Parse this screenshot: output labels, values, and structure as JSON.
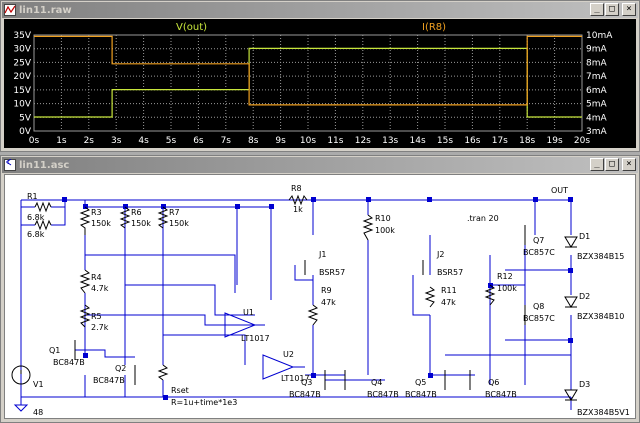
{
  "waveform_window": {
    "title": "lin11.raw",
    "buttons": {
      "minimize": "_",
      "maximize": "□",
      "close": "×"
    },
    "traces": [
      {
        "name": "V(out)",
        "color": "#C8E63C"
      },
      {
        "name": "I(R8)",
        "color": "#F0A020"
      }
    ],
    "left_axis": [
      "35V",
      "30V",
      "25V",
      "20V",
      "15V",
      "10V",
      "5V",
      "0V"
    ],
    "right_axis": [
      "10mA",
      "9mA",
      "8mA",
      "7mA",
      "6mA",
      "5mA",
      "4mA",
      "3mA"
    ],
    "x_axis": [
      "0s",
      "1s",
      "2s",
      "3s",
      "4s",
      "5s",
      "6s",
      "7s",
      "8s",
      "9s",
      "10s",
      "11s",
      "12s",
      "13s",
      "14s",
      "15s",
      "16s",
      "17s",
      "18s",
      "19s",
      "20s"
    ]
  },
  "chart_data": {
    "type": "line",
    "xlabel": "",
    "x_unit": "s",
    "xlim": [
      0,
      20
    ],
    "ylim_left": [
      0,
      35
    ],
    "ylim_right": [
      3,
      10
    ],
    "grid": true,
    "series": [
      {
        "name": "V(out)",
        "axis": "left",
        "color": "#C8E63C",
        "x": [
          0,
          2.85,
          2.85,
          7.85,
          7.85,
          18.0,
          18.0,
          20.0
        ],
        "y": [
          5.1,
          5.1,
          15.1,
          15.1,
          30.1,
          30.1,
          5.1,
          5.1
        ]
      },
      {
        "name": "I(R8)",
        "axis": "right",
        "color": "#F0A020",
        "x": [
          0,
          2.85,
          2.85,
          7.85,
          7.85,
          18.0,
          18.0,
          20.0
        ],
        "y": [
          9.9,
          9.9,
          7.9,
          7.9,
          4.9,
          4.9,
          9.9,
          9.9
        ]
      }
    ]
  },
  "schematic_window": {
    "title": "lin11.asc",
    "buttons": {
      "minimize": "_",
      "maximize": "□",
      "close": "×"
    },
    "labels": {
      "R1": "R1",
      "R1v": "6.8k",
      "R2": "R2",
      "R2v": "6.8k",
      "R3": "R3",
      "R3v": "150k",
      "R6": "R6",
      "R6v": "150k",
      "R7": "R7",
      "R7v": "150k",
      "R4": "R4",
      "R4v": "4.7k",
      "R5": "R5",
      "R5v": "2.7k",
      "Q1": "Q1",
      "Q1v": "BC847B",
      "Q2": "Q2",
      "Q2v": "BC847B",
      "Rset": "Rset",
      "Rsetv": "R=1u+time*1e3",
      "V1": "V1",
      "V1v": "48",
      "R8": "R8",
      "R8v": "1k",
      "U1": "U1",
      "U1v": "LT1017",
      "U2": "U2",
      "U2v": "LT1017",
      "J1": "J1",
      "J1v": "BSR57",
      "R9": "R9",
      "R9v": "47k",
      "R10": "R10",
      "R10v": "100k",
      "Q3": "Q3",
      "Q3v": "BC847B",
      "Q4": "Q4",
      "Q4v": "BC847B",
      "tran": ".tran 20",
      "J2": "J2",
      "J2v": "BSR57",
      "R11": "R11",
      "R11v": "47k",
      "Q5": "Q5",
      "Q5v": "BC847B",
      "Q6": "Q6",
      "Q6v": "BC847B",
      "R12": "R12",
      "R12v": "100k",
      "Q7": "Q7",
      "Q7v": "BC857C",
      "Q8": "Q8",
      "Q8v": "BC857C",
      "OUT": "OUT",
      "D1": "D1",
      "D1v": "BZX384B15",
      "D2": "D2",
      "D2v": "BZX384B10",
      "D3": "D3",
      "D3v": "BZX384B5V1"
    }
  }
}
